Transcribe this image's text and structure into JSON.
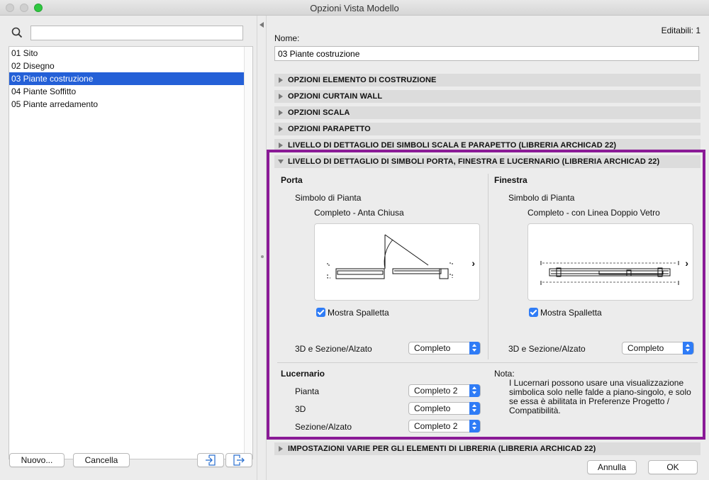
{
  "window": {
    "title": "Opzioni Vista Modello"
  },
  "left": {
    "search_placeholder": "",
    "items": [
      {
        "label": "01 Sito",
        "selected": false
      },
      {
        "label": "02 Disegno",
        "selected": false
      },
      {
        "label": "03 Piante costruzione",
        "selected": true
      },
      {
        "label": "04 Piante Soffitto",
        "selected": false
      },
      {
        "label": "05 Piante arredamento",
        "selected": false
      }
    ],
    "new_button": "Nuovo...",
    "delete_button": "Cancella",
    "import_icon": "import-icon",
    "export_icon": "export-icon"
  },
  "right": {
    "editable": "Editabili: 1",
    "name_label": "Nome:",
    "name_value": "03 Piante costruzione",
    "sections": [
      "OPZIONI ELEMENTO DI COSTRUZIONE",
      "OPZIONI CURTAIN WALL",
      "OPZIONI SCALA",
      "OPZIONI PARAPETTO",
      "LIVELLO DI DETTAGLIO DEI SIMBOLI SCALA E PARAPETTO (LIBRERIA ARCHICAD 22)",
      "LIVELLO DI DETTAGLIO DI SIMBOLI PORTA, FINESTRA E LUCERNARIO (LIBRERIA ARCHICAD 22)",
      "IMPOSTAZIONI VARIE PER GLI ELEMENTI DI LIBRERIA (LIBRERIA ARCHICAD 22)"
    ],
    "porta": {
      "title": "Porta",
      "symbol_label": "Simbolo di Pianta",
      "symbol_value": "Completo - Anta Chiusa",
      "checkbox": "Mostra Spalletta",
      "section_label": "3D e Sezione/Alzato",
      "section_value": "Completo"
    },
    "finestra": {
      "title": "Finestra",
      "symbol_label": "Simbolo di Pianta",
      "symbol_value": "Completo - con Linea Doppio Vetro",
      "checkbox": "Mostra Spalletta",
      "section_label": "3D e Sezione/Alzato",
      "section_value": "Completo"
    },
    "lucernario": {
      "title": "Lucernario",
      "pianta_label": "Pianta",
      "pianta_value": "Completo 2",
      "d3_label": "3D",
      "d3_value": "Completo",
      "sezione_label": "Sezione/Alzato",
      "sezione_value": "Completo 2"
    },
    "nota": {
      "title": "Nota:",
      "body": "I Lucernari possono usare una visualizzazione simbolica solo nelle falde a piano-singolo, e solo se essa è abilitata in Preferenze Progetto / Compatibilità."
    },
    "cancel_button": "Annulla",
    "ok_button": "OK"
  },
  "colors": {
    "selection": "#2460d7",
    "highlight_border": "#8a1a96",
    "accent": "#2f7cf6"
  }
}
